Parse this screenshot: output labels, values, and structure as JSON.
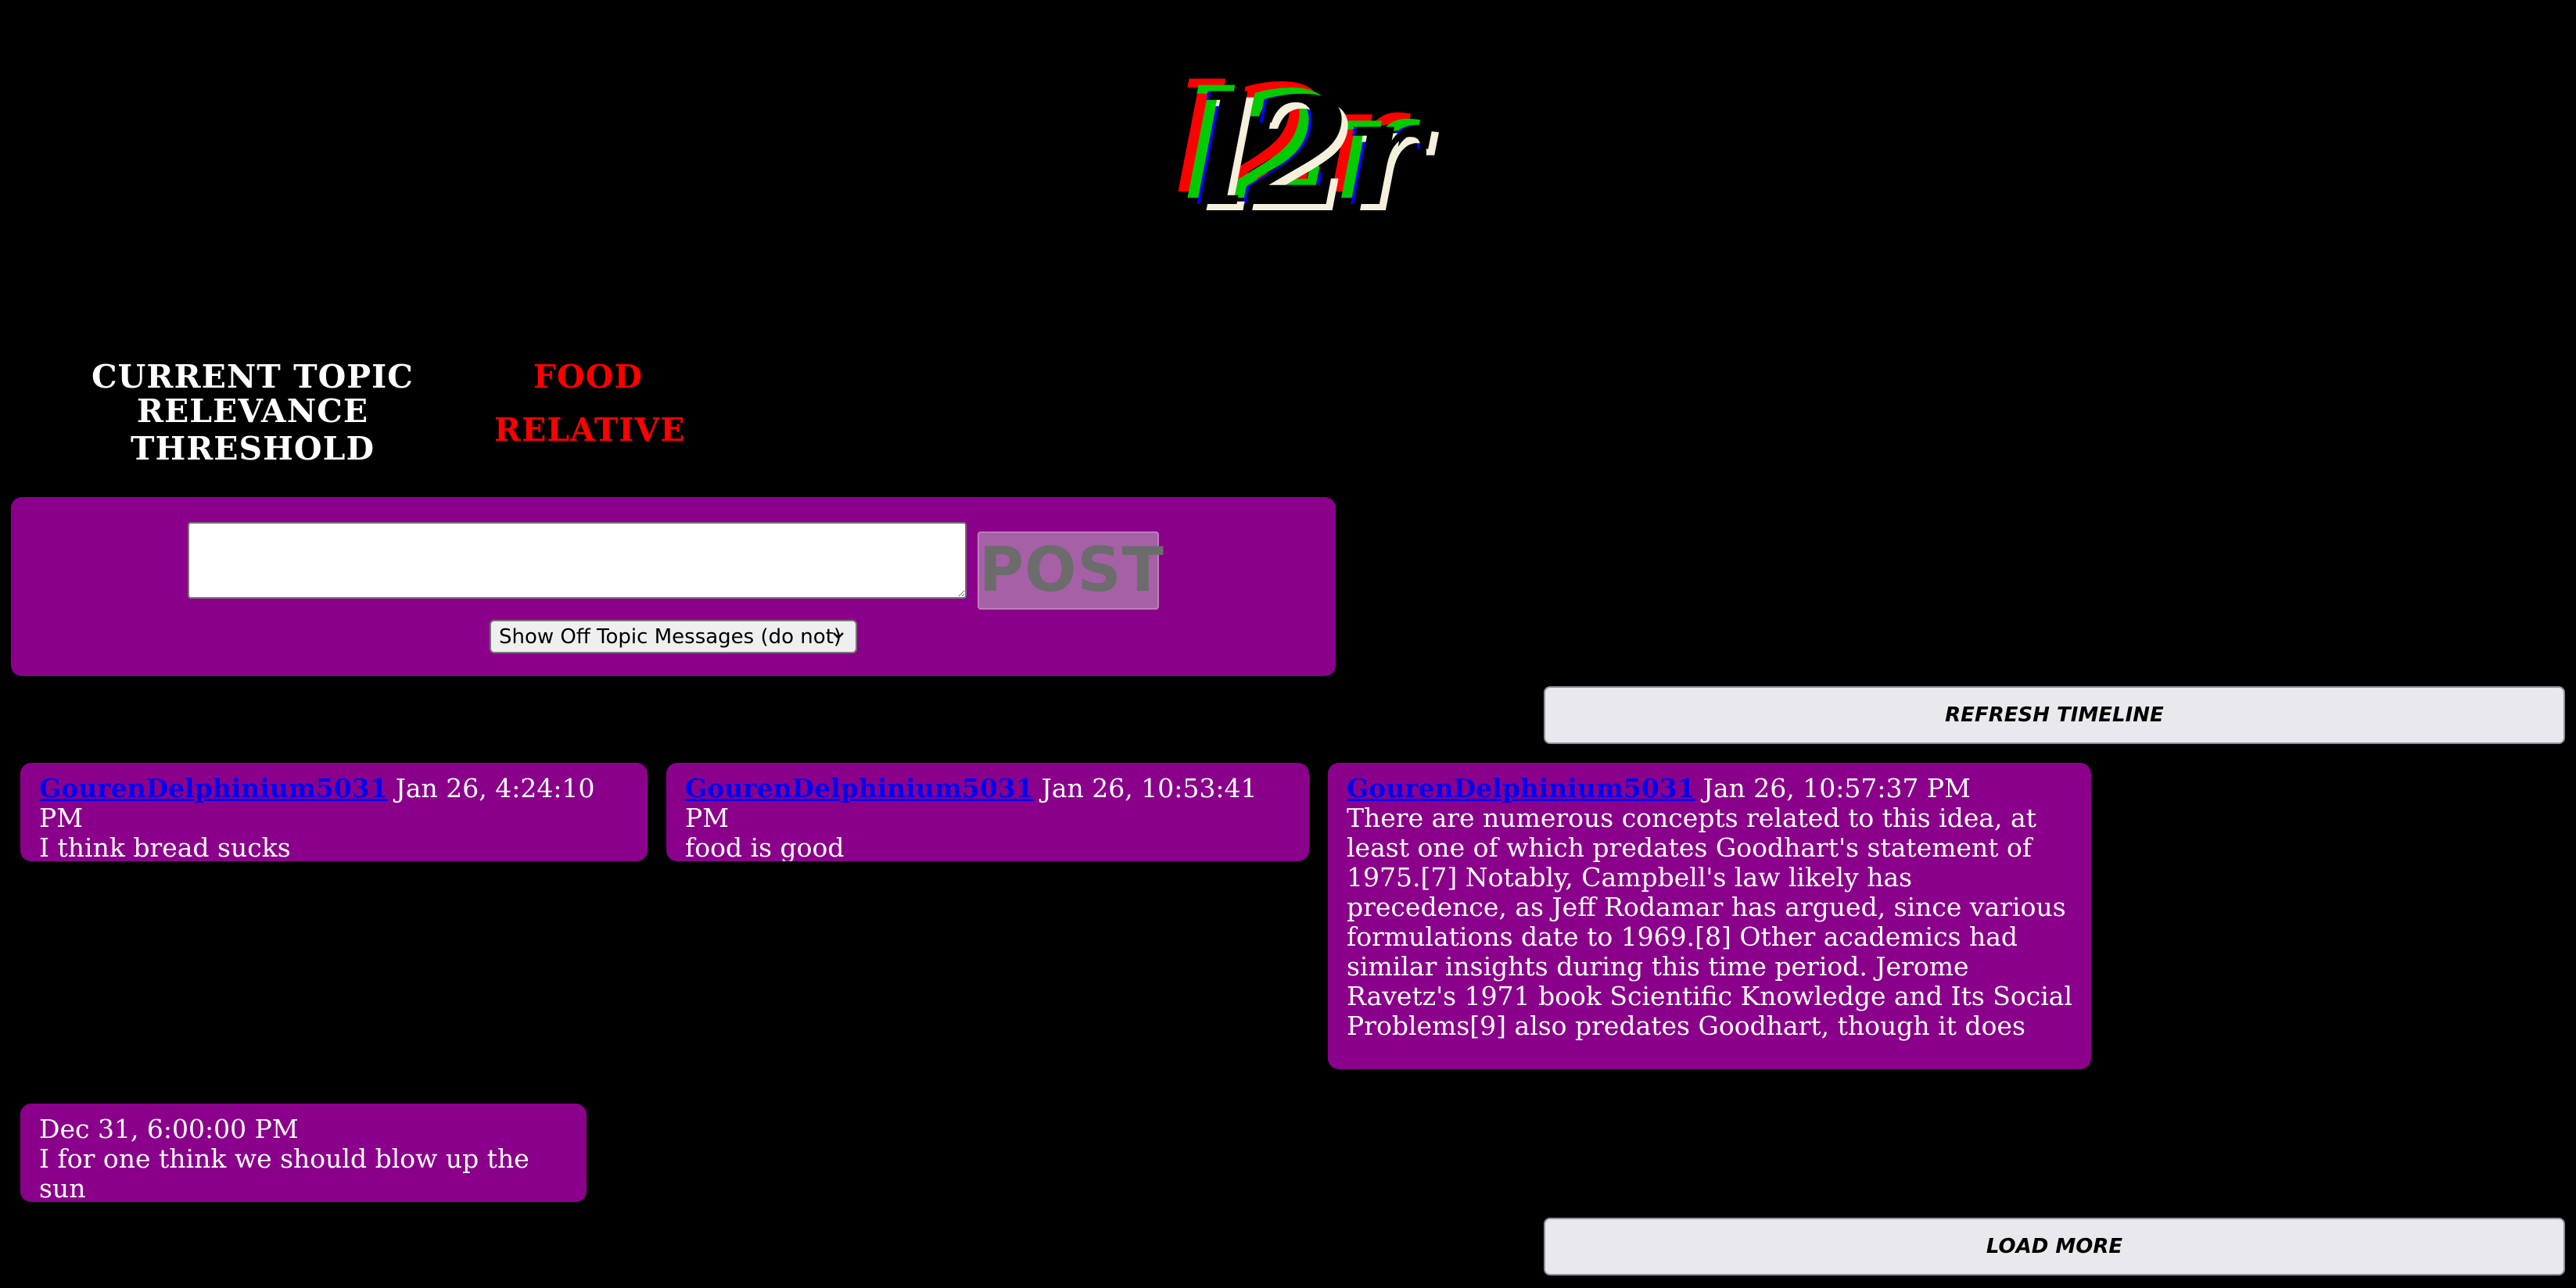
{
  "logo": {
    "text": "l2r",
    "layers": [
      "#ff0000",
      "#00cc00",
      "#0000ff",
      "#f5f0dc"
    ]
  },
  "topic": {
    "current_topic_label": "CURRENT TOPIC",
    "current_topic_value": "FOOD",
    "relevance_label": "RELEVANCE THRESHOLD",
    "relevance_value": "RELATIVE"
  },
  "compose": {
    "input_value": "",
    "post_label": "POST",
    "offtopic_selected": "Show Off Topic Messages (do not)"
  },
  "timeline": {
    "refresh_label": "REFRESH TIMELINE",
    "load_more_label": "LOAD MORE",
    "messages": [
      {
        "author": "GourenDelphinium5031",
        "timestamp": "Jan 26, 4:24:10 PM",
        "body": "I think bread sucks"
      },
      {
        "author": "GourenDelphinium5031",
        "timestamp": "Jan 26, 10:53:41 PM",
        "body": "food is good"
      },
      {
        "author": "GourenDelphinium5031",
        "timestamp": "Jan 26, 10:57:37 PM",
        "body": "There are numerous concepts related to this idea, at least one of which predates Goodhart's statement of 1975.[7] Notably, Campbell's law likely has precedence, as Jeff Rodamar has argued, since various formulations date to 1969.[8] Other academics had similar insights during this time period. Jerome Ravetz's 1971 book Scientific Knowledge and Its Social Problems[9] also predates Goodhart, though it does not formulate the"
      },
      {
        "author": "",
        "timestamp": "Dec 31, 6:00:00 PM",
        "body": "I for one think we should blow up the sun"
      }
    ]
  },
  "colors": {
    "background": "#000000",
    "panel": "#8b008b",
    "accent_red": "#ff0000",
    "link": "#0000ee"
  }
}
